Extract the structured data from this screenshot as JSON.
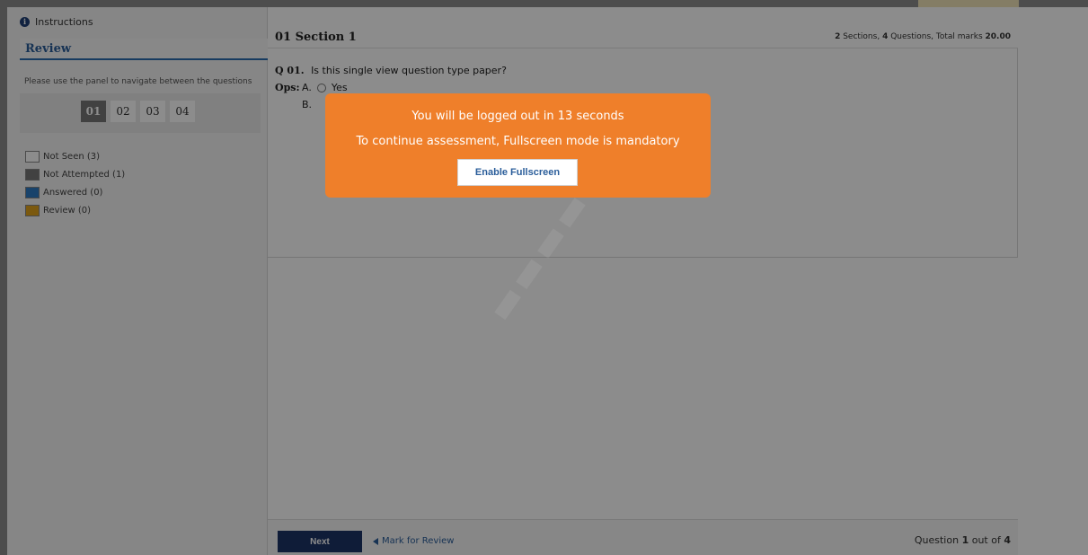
{
  "sidebar": {
    "instructions_label": "Instructions",
    "review_title": "Review",
    "nav_hint": "Please use the panel to navigate between the questions",
    "question_buttons": [
      "01",
      "02",
      "03",
      "04"
    ],
    "legend": [
      {
        "label": "Not Seen (3)",
        "color": "#ffffff"
      },
      {
        "label": "Not Attempted (1)",
        "color": "#777777"
      },
      {
        "label": "Answered (0)",
        "color": "#2f7bc4"
      },
      {
        "label": "Review (0)",
        "color": "#e0a21d"
      }
    ]
  },
  "section": {
    "title": "01  Section 1",
    "sections_count": "2",
    "sections_word": "Sections,",
    "questions_count": "4",
    "questions_word": "Questions, Total marks",
    "total_marks": "20.00"
  },
  "question": {
    "number": "Q 01.",
    "text": "Is this single view question type paper?",
    "ops_label": "Ops:",
    "options": [
      {
        "letter": "A.",
        "text": "Yes"
      },
      {
        "letter": "B.",
        "text": ""
      }
    ]
  },
  "footer": {
    "next_label": "Next",
    "mark_review_label": "Mark for Review",
    "question_word": "Question",
    "current": "1",
    "out_of": "out of",
    "total": "4"
  },
  "modal": {
    "line1": "You will be logged out in 13 seconds",
    "line2": "To continue assessment, Fullscreen mode is mandatory",
    "button_label": "Enable Fullscreen"
  },
  "colors": {
    "modal_bg": "#ef7f2a",
    "accent": "#1d3466",
    "link": "#2a5d9a"
  }
}
